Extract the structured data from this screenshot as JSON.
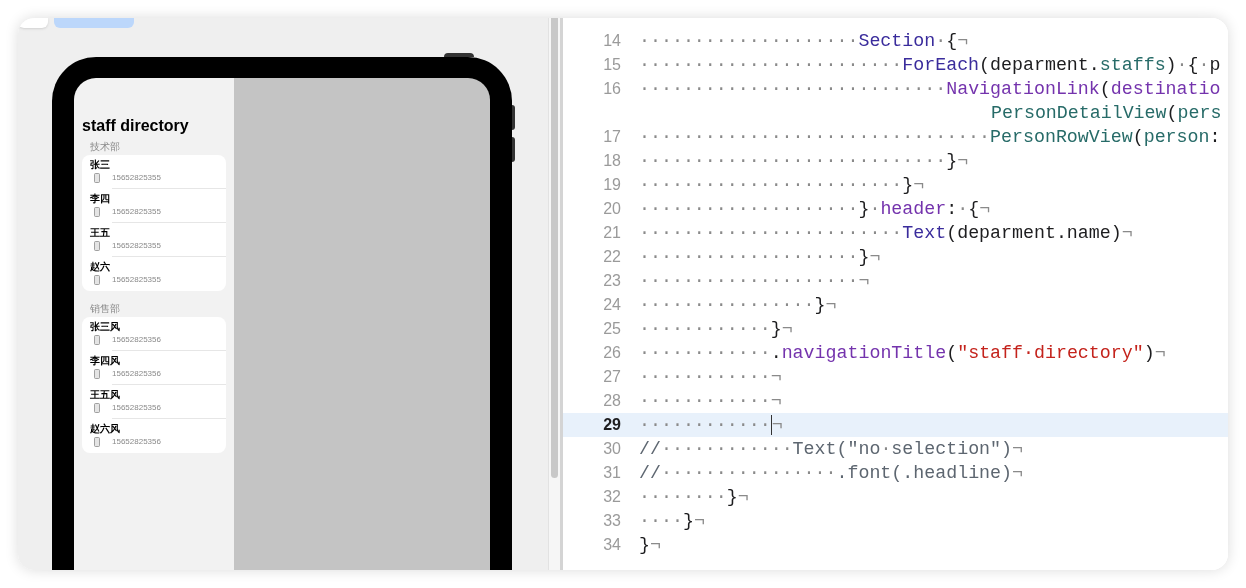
{
  "preview": {
    "screen": {
      "title": "staff directory",
      "sections": [
        {
          "header": "技术部",
          "rows": [
            {
              "name": "张三",
              "phone": "15652825355"
            },
            {
              "name": "李四",
              "phone": "15652825355"
            },
            {
              "name": "王五",
              "phone": "15652825355"
            },
            {
              "name": "赵六",
              "phone": "15652825355"
            }
          ]
        },
        {
          "header": "销售部",
          "rows": [
            {
              "name": "张三风",
              "phone": "15652825356"
            },
            {
              "name": "李四风",
              "phone": "15652825356"
            },
            {
              "name": "王五风",
              "phone": "15652825356"
            },
            {
              "name": "赵六风",
              "phone": "15652825356"
            }
          ]
        }
      ]
    }
  },
  "editor": {
    "lines": [
      {
        "number": "14",
        "current": false,
        "segments": [
          {
            "kind": "ws",
            "text": "····················"
          },
          {
            "kind": "type",
            "text": "Section"
          },
          {
            "kind": "ws",
            "text": "·"
          },
          {
            "kind": "plain",
            "text": "{"
          },
          {
            "kind": "eol",
            "text": "¬"
          }
        ]
      },
      {
        "number": "15",
        "current": false,
        "segments": [
          {
            "kind": "ws",
            "text": "························"
          },
          {
            "kind": "type",
            "text": "ForEach"
          },
          {
            "kind": "plain",
            "text": "(deparment."
          },
          {
            "kind": "project",
            "text": "staffs"
          },
          {
            "kind": "plain",
            "text": ")"
          },
          {
            "kind": "ws",
            "text": "·"
          },
          {
            "kind": "plain",
            "text": "{"
          },
          {
            "kind": "ws",
            "text": "·"
          },
          {
            "kind": "plain",
            "text": "p"
          }
        ]
      },
      {
        "number": "16",
        "current": false,
        "segments": [
          {
            "kind": "ws",
            "text": "····························"
          },
          {
            "kind": "member",
            "text": "NavigationLink"
          },
          {
            "kind": "plain",
            "text": "("
          },
          {
            "kind": "member",
            "text": "destinatio"
          }
        ]
      },
      {
        "kind": "wrap",
        "current": false,
        "segments": [
          {
            "kind": "project",
            "text": "PersonDetailView"
          },
          {
            "kind": "plain",
            "text": "("
          },
          {
            "kind": "project",
            "text": "pers"
          }
        ]
      },
      {
        "number": "17",
        "current": false,
        "segments": [
          {
            "kind": "ws",
            "text": "································"
          },
          {
            "kind": "project",
            "text": "PersonRowView"
          },
          {
            "kind": "plain",
            "text": "("
          },
          {
            "kind": "project",
            "text": "person"
          },
          {
            "kind": "plain",
            "text": ":"
          }
        ]
      },
      {
        "number": "18",
        "current": false,
        "segments": [
          {
            "kind": "ws",
            "text": "····························"
          },
          {
            "kind": "plain",
            "text": "}"
          },
          {
            "kind": "eol",
            "text": "¬"
          }
        ]
      },
      {
        "number": "19",
        "current": false,
        "segments": [
          {
            "kind": "ws",
            "text": "························"
          },
          {
            "kind": "plain",
            "text": "}"
          },
          {
            "kind": "eol",
            "text": "¬"
          }
        ]
      },
      {
        "number": "20",
        "current": false,
        "segments": [
          {
            "kind": "ws",
            "text": "····················"
          },
          {
            "kind": "plain",
            "text": "}"
          },
          {
            "kind": "ws",
            "text": "·"
          },
          {
            "kind": "member",
            "text": "header"
          },
          {
            "kind": "plain",
            "text": ":"
          },
          {
            "kind": "ws",
            "text": "·"
          },
          {
            "kind": "plain",
            "text": "{"
          },
          {
            "kind": "eol",
            "text": "¬"
          }
        ]
      },
      {
        "number": "21",
        "current": false,
        "segments": [
          {
            "kind": "ws",
            "text": "························"
          },
          {
            "kind": "type",
            "text": "Text"
          },
          {
            "kind": "plain",
            "text": "(deparment.name)"
          },
          {
            "kind": "eol",
            "text": "¬"
          }
        ]
      },
      {
        "number": "22",
        "current": false,
        "segments": [
          {
            "kind": "ws",
            "text": "····················"
          },
          {
            "kind": "plain",
            "text": "}"
          },
          {
            "kind": "eol",
            "text": "¬"
          }
        ]
      },
      {
        "number": "23",
        "current": false,
        "segments": [
          {
            "kind": "ws",
            "text": "····················"
          },
          {
            "kind": "eol",
            "text": "¬"
          }
        ]
      },
      {
        "number": "24",
        "current": false,
        "segments": [
          {
            "kind": "ws",
            "text": "················"
          },
          {
            "kind": "plain",
            "text": "}"
          },
          {
            "kind": "eol",
            "text": "¬"
          }
        ]
      },
      {
        "number": "25",
        "current": false,
        "segments": [
          {
            "kind": "ws",
            "text": "············"
          },
          {
            "kind": "plain",
            "text": "}"
          },
          {
            "kind": "eol",
            "text": "¬"
          }
        ]
      },
      {
        "number": "26",
        "current": false,
        "segments": [
          {
            "kind": "ws",
            "text": "············"
          },
          {
            "kind": "plain",
            "text": "."
          },
          {
            "kind": "member",
            "text": "navigationTitle"
          },
          {
            "kind": "plain",
            "text": "("
          },
          {
            "kind": "string",
            "text": "\"staff·directory\""
          },
          {
            "kind": "plain",
            "text": ")"
          },
          {
            "kind": "eol",
            "text": "¬"
          }
        ]
      },
      {
        "number": "27",
        "current": false,
        "segments": [
          {
            "kind": "ws",
            "text": "············"
          },
          {
            "kind": "eol",
            "text": "¬"
          }
        ]
      },
      {
        "number": "28",
        "current": false,
        "segments": [
          {
            "kind": "ws",
            "text": "············"
          },
          {
            "kind": "eol",
            "text": "¬"
          }
        ]
      },
      {
        "number": "29",
        "current": true,
        "segments": [
          {
            "kind": "ws",
            "text": "············"
          },
          {
            "kind": "eol",
            "text": "¬"
          }
        ]
      },
      {
        "number": "30",
        "current": false,
        "segments": [
          {
            "kind": "comment",
            "text": "//"
          },
          {
            "kind": "ws",
            "text": "············"
          },
          {
            "kind": "comment",
            "text": "Text(\"no"
          },
          {
            "kind": "ws",
            "text": "·"
          },
          {
            "kind": "comment",
            "text": "selection\")"
          },
          {
            "kind": "eol",
            "text": "¬"
          }
        ]
      },
      {
        "number": "31",
        "current": false,
        "segments": [
          {
            "kind": "comment",
            "text": "//"
          },
          {
            "kind": "ws",
            "text": "················"
          },
          {
            "kind": "comment",
            "text": ".font(.headline)"
          },
          {
            "kind": "eol",
            "text": "¬"
          }
        ]
      },
      {
        "number": "32",
        "current": false,
        "segments": [
          {
            "kind": "ws",
            "text": "········"
          },
          {
            "kind": "plain",
            "text": "}"
          },
          {
            "kind": "eol",
            "text": "¬"
          }
        ]
      },
      {
        "number": "33",
        "current": false,
        "segments": [
          {
            "kind": "ws",
            "text": "····"
          },
          {
            "kind": "plain",
            "text": "}"
          },
          {
            "kind": "eol",
            "text": "¬"
          }
        ]
      },
      {
        "number": "34",
        "current": false,
        "segments": [
          {
            "kind": "plain",
            "text": "}"
          },
          {
            "kind": "eol",
            "text": "¬"
          }
        ]
      }
    ]
  }
}
